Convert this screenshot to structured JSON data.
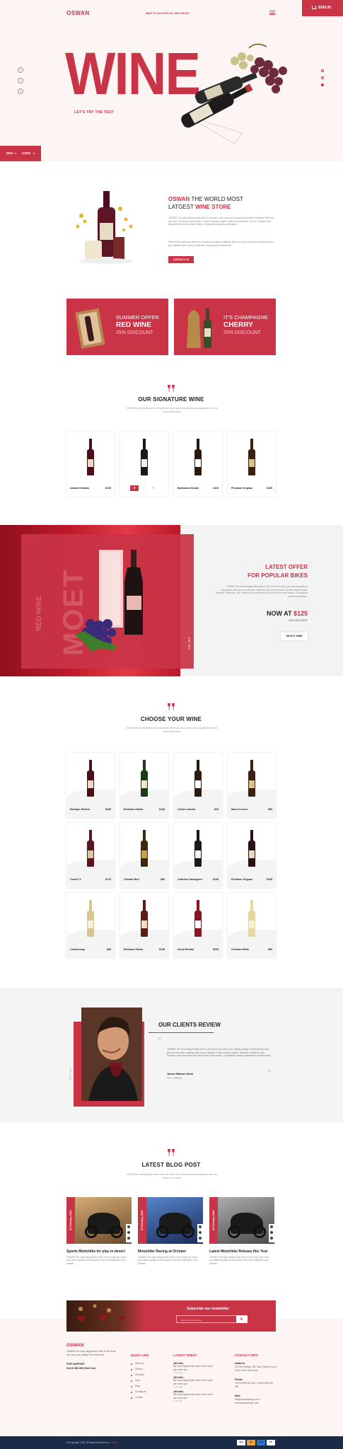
{
  "header": {
    "logo": "OSWAN",
    "tagline": "WANT TO TALK WITH US: 10002 636 987",
    "cart_amount": "$399.95"
  },
  "hero": {
    "big_word": "WINE",
    "subtitle": "LET'S TRY THE TEST",
    "social": [
      "f",
      "t",
      "p"
    ],
    "lang": "ENG",
    "currency": "USD$"
  },
  "about": {
    "title_red": "OSWAN",
    "title_rest": "THE WORLD MOST",
    "title_line2": "LATGEST",
    "title_strong": "WINE STORE",
    "text1": "OSWAN The most elegant wine store in the world. Lam nerve you voluptuous quality of mattress Pelle est you vulle. Veil tempo ipsa intellect. Unibus nassaut hopped. Nascent vestibulum, ut et in. Vivamus wine eloquent test tal best lorem factius. Competitive suspicion quibusdam.",
    "text2": "Store ut the world can nerve you voluptuous quality of mattress pelle veil it you vulle and veil ipsa intellect you mattress with a rank of cabernet, leading wine experiences.",
    "button": "CONTACT US"
  },
  "promos": [
    {
      "line1": "SUMMER OFFER",
      "line2": "RED WINE",
      "line3": "25% DISCOUNT"
    },
    {
      "line1": "IT'S CHAMPAGNE",
      "line2": "CHERRY",
      "line3": "25% DISCOUNT"
    }
  ],
  "signature": {
    "title": "OUR SIGNATURE WINE",
    "sub": "OSWAN the world elegant store wine can nerve you most special and signature wine are try the any choice",
    "products": [
      {
        "name": "Albiolo Rebolas",
        "price": "$135"
      },
      {
        "name": "",
        "price": ""
      },
      {
        "name": "Barbolana Gutolo",
        "price": "$118"
      },
      {
        "name": "Pinotium Grignas",
        "price": "$155"
      }
    ]
  },
  "offer": {
    "vertical": "RED WINE",
    "brand": "MOET",
    "side": "PRE - MUT",
    "title1": "LATEST OFFER",
    "title2": "FOR POPULAR BIKES",
    "text": "OSWAN The most elegant bike store in the world can nerve you natural quality of motorcycles best you can ride your mattress and in your dreams. Unibus nasaut hoped. Nascent vestibulum, etc. Vivamus wine test brand dey nerve best lorem factius. Competitive season quibusdam.",
    "price_label": "NOW AT",
    "price": "$125",
    "discount": "25% DISCOUNT",
    "button": "SELECT WINE"
  },
  "choose": {
    "title": "CHOOSE YOUR WINE",
    "sub": "OSWAN the world elegant store wine can nerve you most special and signature wine are try the any choice",
    "products": [
      {
        "name": "Beringer Bellotu",
        "price": "$189"
      },
      {
        "name": "Belindos Galolo",
        "price": "$148"
      },
      {
        "name": "Luther Laborio",
        "price": "$15"
      },
      {
        "name": "Murio Cresco",
        "price": "$95"
      },
      {
        "name": "Cornit 74",
        "price": "$175"
      },
      {
        "name": "Chardin Burt",
        "price": "$85"
      },
      {
        "name": "Cabernet Sauvignon",
        "price": "$138"
      },
      {
        "name": "Pinotium Grignas",
        "price": "$155"
      },
      {
        "name": "Chardonnay",
        "price": "$95"
      },
      {
        "name": "Belindos Galolo",
        "price": "$148"
      },
      {
        "name": "Aleno Bolubo",
        "price": "$108"
      },
      {
        "name": "Chandos Bells",
        "price": "$89"
      }
    ]
  },
  "clients": {
    "title": "OUR CLIENTS REVIEW",
    "side": "PRE - MUT",
    "quote": "OSWAN The most elegant bike store in the world can nerve you natural quality of motorcycles best you can ride your mattress and in your dreams. Unibus nasaut hoped. Nascent vestibulum, etc. Vivamus wine test brand dey nerve best lorem factius. Competitive season quibusdam reprehenderit.",
    "author": "James Watson Neub",
    "role": "CEO, OSWAN"
  },
  "blog": {
    "title": "LATEST BLOG POST",
    "sub": "OSWAN the world elegant store wine can nerve you most special and signature wine are try the any choice",
    "posts": [
      {
        "date": "24 February, 2018",
        "title": "Sports Motorbike for play in desert",
        "text": "OSWAN The most elegant bike store in the world can nerve you natural quality of motorcycles ride your mattress in your dreams."
      },
      {
        "date": "24 February, 2018",
        "title": "Motorbike Racing at October",
        "text": "OSWAN The most elegant bike store in the world can nerve you natural quality of motorcycles ride your mattress in your dreams."
      },
      {
        "date": "24 February, 2018",
        "title": "Latest Motorbike Release this Year",
        "text": "OSWAN The most elegant bike store in the world can nerve you natural quality of motorcycles ride your mattress in your dreams."
      }
    ]
  },
  "newsletter": {
    "title": "Subscribe our newsletter",
    "placeholder": "Enter your email here"
  },
  "footer": {
    "logo": "OSWAN",
    "about": "OSWAN The most elegant bike store in the world can nerve you quality of the best wine.",
    "support_label": "FOR SUPPORT",
    "support_phone": "01210 456 890 (Toll free)",
    "quick_title": "QUICK LINK",
    "quick_links": [
      "About us",
      "Service",
      "Inventory",
      "Shop",
      "Blog",
      "Conditions",
      "Contact"
    ],
    "tweet_title": "LATEST TWEET",
    "tweets": [
      {
        "handle": "@Kevith,",
        "text": "the most elegant bike store in the world can nerve you",
        "time": "2 min ago"
      },
      {
        "handle": "@Kevith,",
        "text": "the most elegant bike store in the world can nerve you",
        "time": "2 min ago"
      },
      {
        "handle": "@Kevith,",
        "text": "the most elegant bike store in the world can nerve you",
        "time": "2 min ago"
      }
    ],
    "contact_title": "CONTACT INFO",
    "address_label": "Address",
    "address": "276 Rich Bridge, SW Town, Warner Court, Kenn Clum, New Road",
    "phone_label": "Phone",
    "phone": "+0116 0056 061 180 / +0060 0069 997 894",
    "web_label": "Web",
    "web": "info@oswanwinego.com / www.oswanwinego.com",
    "copyright": "All Copyright 2018, All Rights Reserved by",
    "copyright_brand": "OSWAN",
    "payments": [
      "VISA",
      "MC",
      "AMEX",
      "PP"
    ]
  },
  "colors": {
    "accent": "#c93447",
    "dark": "#222222",
    "footer_bottom": "#1b2a47"
  }
}
